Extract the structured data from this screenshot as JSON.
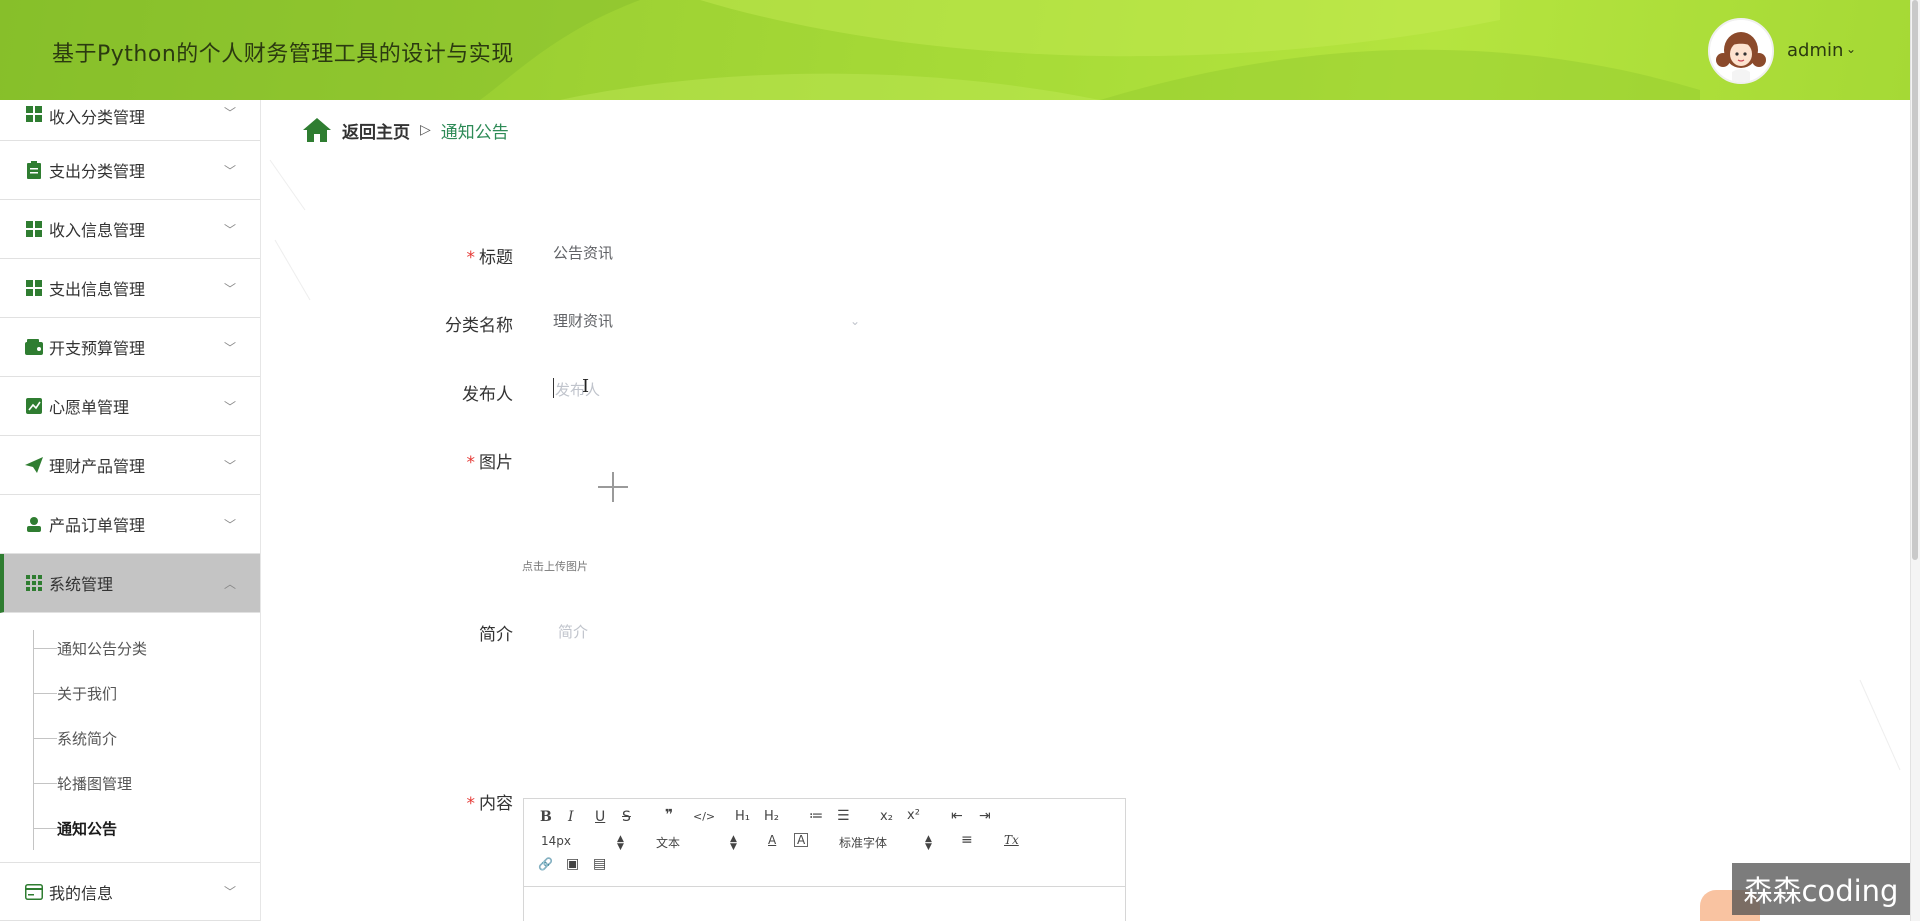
{
  "header": {
    "title": "基于Python的个人财务管理工具的设计与实现",
    "user_name": "admin",
    "colors": {
      "bg_start": "#8cc42a",
      "bg_end": "#b5e43f"
    }
  },
  "sidebar": {
    "items": [
      {
        "label": "收入分类管理",
        "icon": "grid-icon"
      },
      {
        "label": "支出分类管理",
        "icon": "clipboard-icon"
      },
      {
        "label": "收入信息管理",
        "icon": "grid-icon"
      },
      {
        "label": "支出信息管理",
        "icon": "grid-icon"
      },
      {
        "label": "开支预算管理",
        "icon": "wallet-icon"
      },
      {
        "label": "心愿单管理",
        "icon": "chart-icon"
      },
      {
        "label": "理财产品管理",
        "icon": "send-icon"
      },
      {
        "label": "产品订单管理",
        "icon": "user-icon"
      },
      {
        "label": "系统管理",
        "icon": "apps-icon",
        "expanded": true
      },
      {
        "label": "我的信息",
        "icon": "card-icon"
      }
    ],
    "sub_items": [
      "通知公告分类",
      "关于我们",
      "系统简介",
      "轮播图管理",
      "通知公告"
    ],
    "current_sub": "通知公告",
    "accent": "#2f7d31"
  },
  "breadcrumb": {
    "back": "返回主页",
    "separator": "▷",
    "current": "通知公告"
  },
  "form": {
    "title_label": "标题",
    "title_value": "公告资讯",
    "category_label": "分类名称",
    "category_value": "理财资讯",
    "publisher_label": "发布人",
    "publisher_placeholder": "发布人",
    "image_label": "图片",
    "upload_hint": "点击上传图片",
    "intro_label": "简介",
    "intro_placeholder": "简介",
    "content_label": "内容",
    "required_mark": "*"
  },
  "editor": {
    "font_size": "14px",
    "text_style": "文本",
    "font_family": "标准字体",
    "buttons": {
      "bold": "B",
      "italic": "I",
      "underline": "U",
      "strike": "S",
      "quote": "❞",
      "code": "</>",
      "h1": "H₁",
      "h2": "H₂",
      "ordered_list": "≔",
      "bullet_list": "☰",
      "subscript": "x₂",
      "superscript": "x²",
      "outdent": "⇤",
      "indent": "⇥",
      "font_color": "A",
      "bg_color": "A",
      "align": "≡",
      "clear": "Tx",
      "link": "🔗",
      "image": "▣",
      "video": "▤"
    }
  },
  "watermark": "森森coding"
}
